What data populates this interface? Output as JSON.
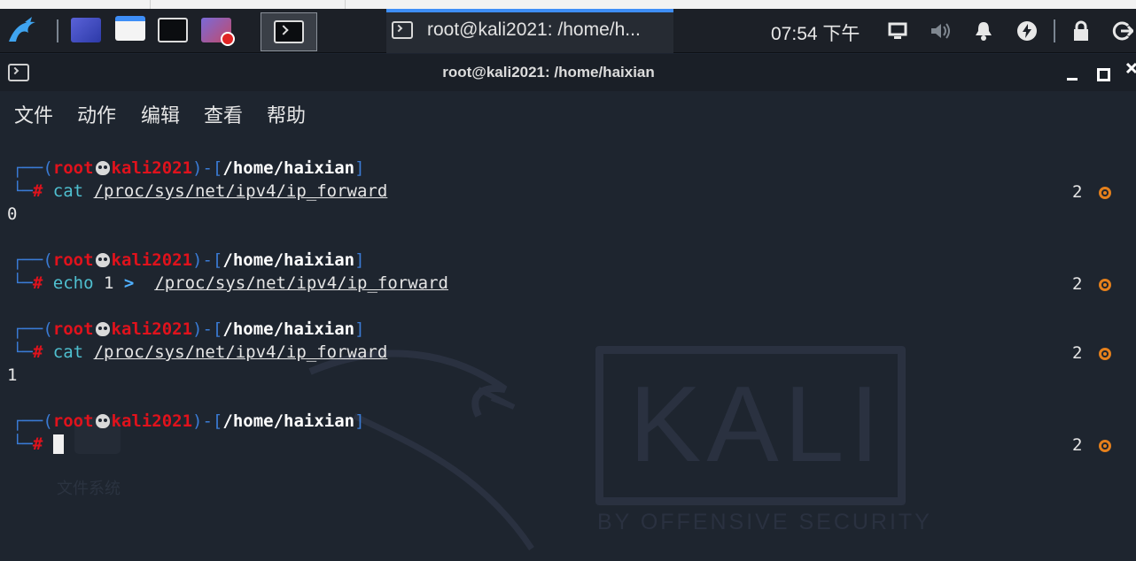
{
  "taskbar": {
    "window_button_label": "root@kali2021: /home/h...",
    "clock": "07:54 下午"
  },
  "terminal": {
    "title": "root@kali2021: /home/haixian",
    "menu": [
      "文件",
      "动作",
      "编辑",
      "查看",
      "帮助"
    ],
    "prompt": {
      "open": "┌──(",
      "user": "root",
      "host": "kali2021",
      "mid": ")-[",
      "path": "/home/haixian",
      "close": "]",
      "line2": "└─",
      "hash": "#"
    },
    "blocks": [
      {
        "cmd": "cat",
        "op": "",
        "arg": "/proc/sys/net/ipv4/ip_forward",
        "output": "0",
        "right_status": "2"
      },
      {
        "cmd": "echo",
        "value": "1",
        "op": ">",
        "arg": "/proc/sys/net/ipv4/ip_forward",
        "output": "",
        "right_status": "2"
      },
      {
        "cmd": "cat",
        "op": "",
        "arg": "/proc/sys/net/ipv4/ip_forward",
        "output": "1",
        "right_status": "2"
      },
      {
        "cmd": "",
        "op": "",
        "arg": "",
        "output": "",
        "right_status": "2"
      }
    ]
  },
  "wallpaper": {
    "logo_text": "KALI",
    "tagline": "BY OFFENSIVE SECURITY",
    "desktop_icon_label": "文件系统"
  },
  "colors": {
    "accent": "#3e8ef7",
    "prompt_red": "#e0121c",
    "prompt_blue": "#3a7bd5",
    "command_cyan": "#4fc0d0",
    "status_orange": "#e5801c",
    "background": "#1e252f"
  }
}
